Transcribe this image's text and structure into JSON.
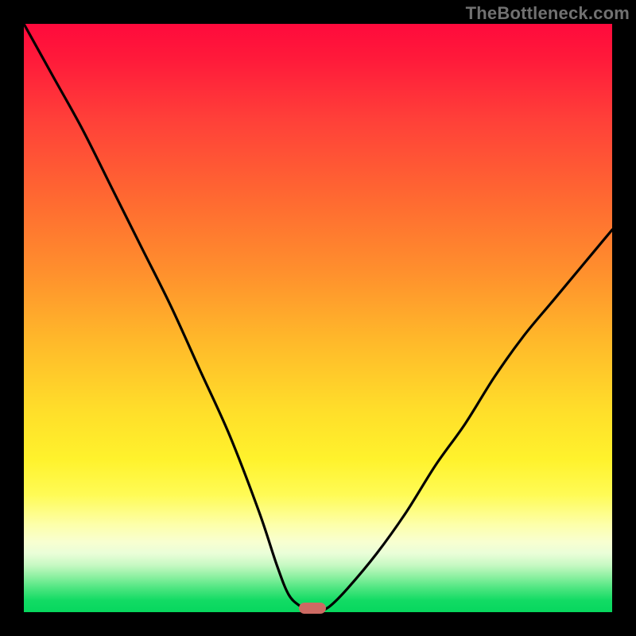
{
  "watermark": "TheBottleneck.com",
  "colors": {
    "frame": "#000000",
    "marker": "#cd6a63",
    "curve_stroke": "#000000",
    "watermark_text": "#717171"
  },
  "chart_data": {
    "type": "line",
    "title": "",
    "xlabel": "",
    "ylabel": "",
    "xlim": [
      0,
      100
    ],
    "ylim": [
      0,
      100
    ],
    "series": [
      {
        "name": "bottleneck-curve",
        "x": [
          0,
          5,
          10,
          15,
          20,
          25,
          30,
          35,
          40,
          43,
          45,
          47,
          49,
          50,
          52,
          55,
          60,
          65,
          70,
          75,
          80,
          85,
          90,
          95,
          100
        ],
        "values": [
          100,
          91,
          82,
          72,
          62,
          52,
          41,
          30,
          17,
          8,
          3,
          1,
          0,
          0,
          1,
          4,
          10,
          17,
          25,
          32,
          40,
          47,
          53,
          59,
          65
        ]
      }
    ],
    "marker": {
      "x": 49,
      "y": 0,
      "shape": "pill"
    },
    "background_gradient": {
      "direction": "vertical",
      "stops": [
        {
          "pos": 0,
          "color": "#ff0a3c"
        },
        {
          "pos": 30,
          "color": "#ff6a31"
        },
        {
          "pos": 66,
          "color": "#ffdf2a"
        },
        {
          "pos": 85,
          "color": "#fdffa8"
        },
        {
          "pos": 100,
          "color": "#07d75e"
        }
      ]
    }
  }
}
